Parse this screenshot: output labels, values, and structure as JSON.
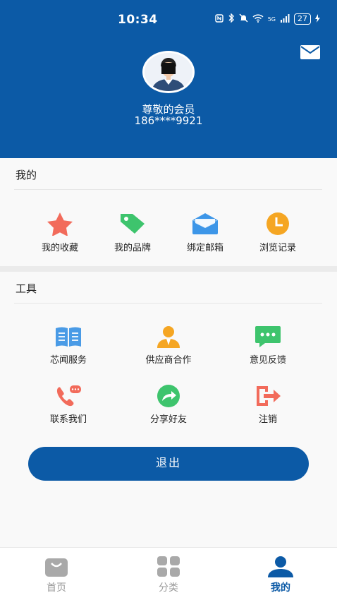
{
  "status_bar": {
    "time": "10:34",
    "signal_text": "5G",
    "battery": "27"
  },
  "header": {
    "username": "尊敬的会员",
    "phone": "186****9921",
    "mail_icon": "mail-icon"
  },
  "mine": {
    "title": "我的",
    "items": [
      {
        "label": "我的收藏",
        "icon": "star-icon",
        "color": "#f26b5b"
      },
      {
        "label": "我的品牌",
        "icon": "tag-icon",
        "color": "#3ec46d"
      },
      {
        "label": "绑定邮箱",
        "icon": "mailbox-icon",
        "color": "#3d96e8"
      },
      {
        "label": "浏览记录",
        "icon": "clock-icon",
        "color": "#f5a623"
      }
    ]
  },
  "tools": {
    "title": "工具",
    "items": [
      {
        "label": "芯闻服务",
        "icon": "book-icon",
        "color": "#4a9be6"
      },
      {
        "label": "供应商合作",
        "icon": "supplier-icon",
        "color": "#f5a623"
      },
      {
        "label": "意见反馈",
        "icon": "feedback-icon",
        "color": "#3ec46d"
      },
      {
        "label": "联系我们",
        "icon": "phone-icon",
        "color": "#f26b5b"
      },
      {
        "label": "分享好友",
        "icon": "share-icon",
        "color": "#3ec46d"
      },
      {
        "label": "注销",
        "icon": "logout-icon",
        "color": "#f26b5b"
      }
    ]
  },
  "logout_button": "退出",
  "tabbar": {
    "tabs": [
      {
        "label": "首页",
        "icon": "home-bag-icon",
        "active": false
      },
      {
        "label": "分类",
        "icon": "category-grid-icon",
        "active": false
      },
      {
        "label": "我的",
        "icon": "user-icon",
        "active": true
      }
    ]
  },
  "colors": {
    "primary": "#0c5aa6",
    "background": "#f6f6f6"
  }
}
